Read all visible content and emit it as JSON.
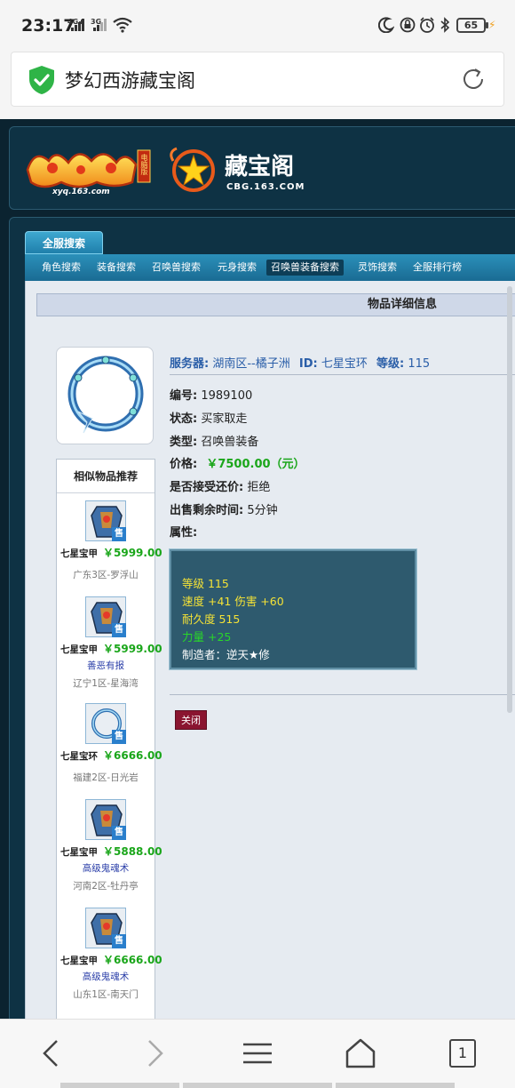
{
  "status_bar": {
    "time": "23:17",
    "net1": "4G+",
    "net2": "3G",
    "battery": "65"
  },
  "browser": {
    "page_title": "梦幻西游藏宝阁"
  },
  "site": {
    "logo_left_sub": "xyq.163.com",
    "logo_left_badge": "电脑版",
    "logo_right_title": "藏宝阁",
    "logo_right_sub": "CBG.163.COM",
    "tab_all": "全服搜索",
    "nav": [
      "角色搜索",
      "装备搜索",
      "召唤兽搜索",
      "元身搜索",
      "召唤兽装备搜索",
      "灵饰搜索",
      "全服排行榜"
    ],
    "nav_active_index": 4
  },
  "detail": {
    "header": "物品详细信息",
    "server_label": "服务器:",
    "server_value": "湖南区--橘子洲",
    "id_label": "ID:",
    "id_value": "七星宝环",
    "level_label": "等级:",
    "level_value": "115",
    "code_label": "编号:",
    "code_value": "1989100",
    "status_label": "状态:",
    "status_value": "买家取走",
    "type_label": "类型:",
    "type_value": "召唤兽装备",
    "price_label": "价格:",
    "price_value": "￥7500.00（元）",
    "bargain_label": "是否接受还价:",
    "bargain_value": "拒绝",
    "time_left_label": "出售剩余时间:",
    "time_left_value": "5分钟",
    "attr_label": "属性:",
    "attributes": [
      {
        "text": "等级 115",
        "color": "yellow"
      },
      {
        "text": "速度 +41 伤害 +60",
        "color": "yellow"
      },
      {
        "text": "耐久度 515",
        "color": "yellow"
      },
      {
        "text": "力量 +25",
        "color": "green"
      },
      {
        "text": "制造者：逆天★修",
        "color": "white"
      }
    ],
    "close_label": "关闭"
  },
  "recommend": {
    "title": "相似物品推荐",
    "sell_badge": "售",
    "items": [
      {
        "name": "七星宝甲",
        "price": "￥5999.00",
        "skill": "",
        "server": "广东3区-罗浮山",
        "icon": "armor-icon"
      },
      {
        "name": "七星宝甲",
        "price": "￥5999.00",
        "skill": "善恶有报",
        "server": "辽宁1区-星海湾",
        "icon": "armor-icon"
      },
      {
        "name": "七星宝环",
        "price": "￥6666.00",
        "skill": "",
        "server": "福建2区-日光岩",
        "icon": "ring-icon"
      },
      {
        "name": "七星宝甲",
        "price": "￥5888.00",
        "skill": "高级鬼魂术",
        "server": "河南2区-牡丹亭",
        "icon": "armor-icon"
      },
      {
        "name": "七星宝甲",
        "price": "￥6666.00",
        "skill": "高级鬼魂术",
        "server": "山东1区-南天门",
        "icon": "armor-icon"
      }
    ]
  },
  "bottom_nav": {
    "tab_count": "1"
  },
  "colors": {
    "accent_green": "#1aa61a",
    "link_blue": "#2a5ea8",
    "close_red": "#8a1530",
    "site_bg": "#0b2330"
  }
}
